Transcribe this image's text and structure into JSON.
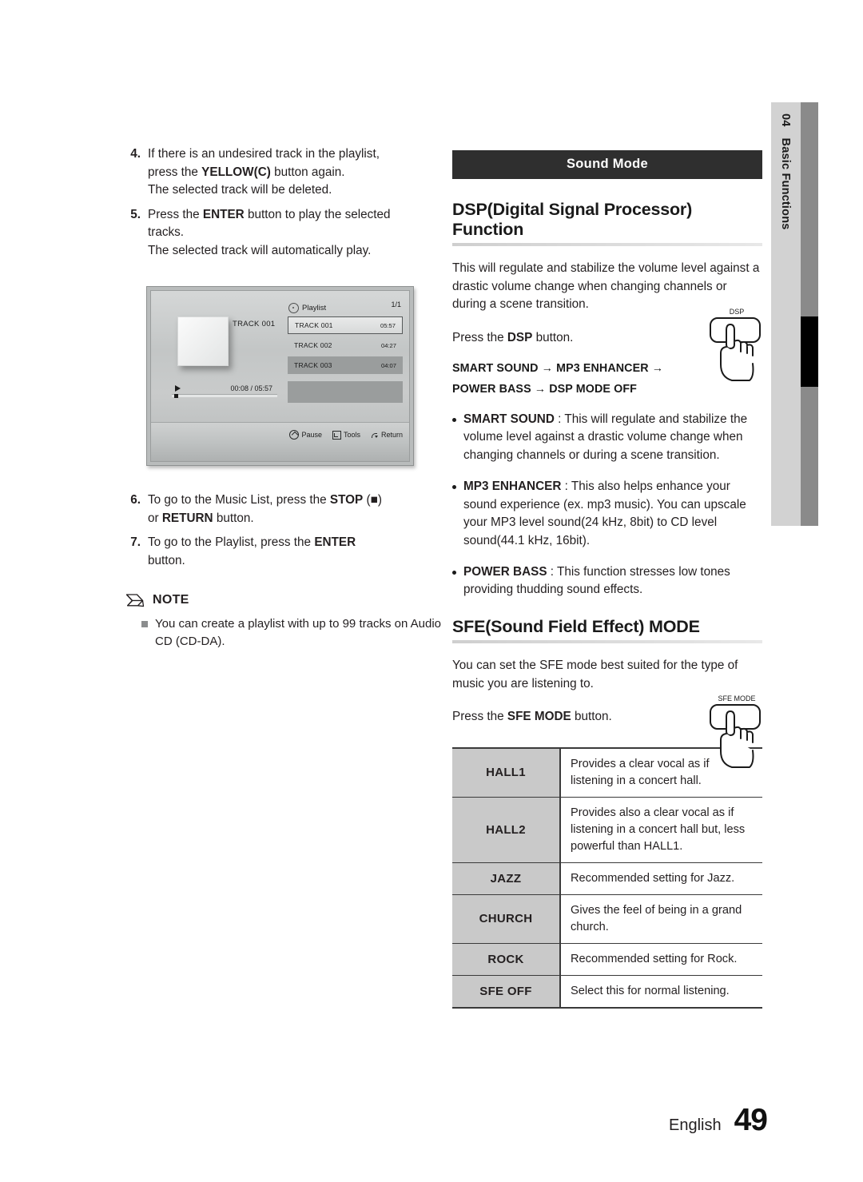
{
  "document": {
    "section_number": "04",
    "section_name": "Basic Functions",
    "footer_language": "English",
    "page_number": "49"
  },
  "left_column": {
    "steps": [
      {
        "num": "4.",
        "lines": [
          {
            "parts": [
              {
                "t": "If there is an undesired track in the playlist,",
                "b": false
              }
            ]
          },
          {
            "parts": [
              {
                "t": "press the ",
                "b": false
              },
              {
                "t": "YELLOW(C)",
                "b": true
              },
              {
                "t": " button again.",
                "b": false
              }
            ]
          },
          {
            "parts": [
              {
                "t": "The selected track will be deleted.",
                "b": false
              }
            ]
          }
        ]
      },
      {
        "num": "5.",
        "lines": [
          {
            "parts": [
              {
                "t": "Press the ",
                "b": false
              },
              {
                "t": "ENTER",
                "b": true
              },
              {
                "t": " button to play the selected",
                "b": false
              }
            ]
          },
          {
            "parts": [
              {
                "t": "tracks.",
                "b": false
              }
            ]
          },
          {
            "parts": [
              {
                "t": "The selected track will automatically play.",
                "b": false
              }
            ]
          }
        ]
      }
    ],
    "steps_after": [
      {
        "num": "6.",
        "lines": [
          {
            "parts": [
              {
                "t": "To go to the Music List, press the ",
                "b": false
              },
              {
                "t": "STOP",
                "b": true
              },
              {
                "t": " (■)",
                "b": false
              }
            ]
          },
          {
            "parts": [
              {
                "t": "or ",
                "b": false
              },
              {
                "t": "RETURN",
                "b": true
              },
              {
                "t": " button.",
                "b": false
              }
            ]
          }
        ]
      },
      {
        "num": "7.",
        "lines": [
          {
            "parts": [
              {
                "t": "To go to the Playlist, press the ",
                "b": false
              },
              {
                "t": "ENTER",
                "b": true
              }
            ]
          },
          {
            "parts": [
              {
                "t": "button.",
                "b": false
              }
            ]
          }
        ]
      }
    ],
    "note": {
      "icon": "pencil-icon",
      "title": "NOTE",
      "items": [
        "You can create a playlist with up to 99 tracks on Audio CD (CD-DA)."
      ]
    }
  },
  "tv_screenshot": {
    "now_playing_label": "TRACK 001",
    "playlist_header": "Playlist",
    "page_indicator": "1/1",
    "tracks": [
      {
        "title": "TRACK 001",
        "duration": "05:57",
        "state": "selected"
      },
      {
        "title": "TRACK 002",
        "duration": "04:27",
        "state": "plain"
      },
      {
        "title": "TRACK 003",
        "duration": "04:07",
        "state": "highlight"
      }
    ],
    "progress": {
      "elapsed_total": "00:08 / 05:57",
      "percent": 2
    },
    "footer_buttons": [
      {
        "icon": "pause-icon",
        "label": "Pause"
      },
      {
        "icon": "tools-icon",
        "label": "Tools"
      },
      {
        "icon": "return-icon",
        "label": "Return"
      }
    ]
  },
  "right_column": {
    "section_bar": "Sound Mode",
    "dsp": {
      "heading": "DSP(Digital Signal Processor) Function",
      "intro": "This will regulate and stabilize the volume level against a drastic volume change when changing channels or during a scene transition.",
      "press_prefix": "Press the ",
      "press_button": "DSP",
      "press_suffix": " button.",
      "button_illustration_label": "DSP",
      "flow_line_1": "SMART SOUND  → MP3 ENHANCER →",
      "flow_line_2": "POWER BASS  →  DSP MODE OFF",
      "bullets": [
        {
          "term": "SMART SOUND",
          "sep": " : ",
          "text": "This will regulate and stabilize the volume level against a drastic volume change when changing channels or during a scene transition."
        },
        {
          "term": "MP3 ENHANCER",
          "sep": " : ",
          "text": "This also helps enhance your sound experience (ex. mp3 music). You can upscale your MP3 level sound(24 kHz, 8bit) to CD level sound(44.1 kHz, 16bit)."
        },
        {
          "term": "POWER BASS",
          "sep": " : ",
          "text": "This function stresses low tones providing thudding sound effects."
        }
      ]
    },
    "sfe": {
      "heading": "SFE(Sound Field Effect) MODE",
      "intro": "You can set the SFE mode best suited for the type of music you are listening to.",
      "press_prefix": "Press the ",
      "press_button": "SFE MODE",
      "press_suffix": " button.",
      "button_illustration_label": "SFE MODE",
      "table": [
        {
          "mode": "HALL1",
          "description": "Provides a clear vocal as if listening in a concert hall."
        },
        {
          "mode": "HALL2",
          "description": "Provides also a clear vocal as if listening in a concert hall but, less powerful than HALL1."
        },
        {
          "mode": "JAZZ",
          "description": "Recommended setting for Jazz."
        },
        {
          "mode": "CHURCH",
          "description": "Gives the feel of being in a grand church."
        },
        {
          "mode": "ROCK",
          "description": "Recommended setting for Rock."
        },
        {
          "mode": "SFE OFF",
          "description": "Select this for normal listening."
        }
      ]
    }
  },
  "colors": {
    "section_bar_bg": "#2f2f2f",
    "table_mode_bg": "#c9c9c9",
    "thumb_tab_bg": "#d2d2d2",
    "thumb_bar_bg": "#8a8a8a",
    "thumb_marker": "#000000"
  }
}
